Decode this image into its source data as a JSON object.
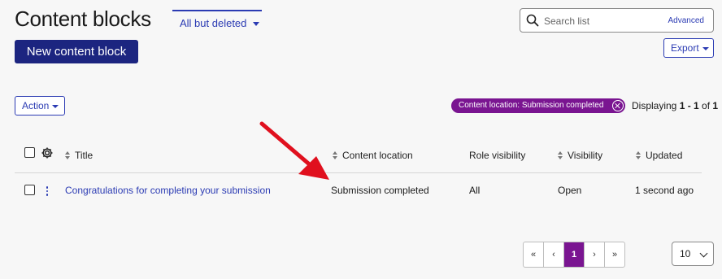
{
  "page": {
    "title": "Content blocks"
  },
  "filter": {
    "label": "All but deleted"
  },
  "toolbar": {
    "new_label": "New content block",
    "export_label": "Export",
    "action_label": "Action"
  },
  "search": {
    "placeholder": "Search list",
    "advanced_label": "Advanced"
  },
  "active_filter": {
    "label": "Content location: Submission completed"
  },
  "displaying": {
    "prefix": "Displaying ",
    "range": "1 - 1",
    "of": " of ",
    "total": "1"
  },
  "table": {
    "columns": [
      "Title",
      "Content location",
      "Role visibility",
      "Visibility",
      "Updated"
    ],
    "rows": [
      {
        "title": "Congratulations for completing your submission",
        "content_location": "Submission completed",
        "role_visibility": "All",
        "visibility": "Open",
        "updated": "1 second ago"
      }
    ]
  },
  "pagination": {
    "first": "«",
    "prev": "‹",
    "current": "1",
    "next": "›",
    "last": "»"
  },
  "per_page": {
    "value": "10"
  },
  "colors": {
    "primary": "#1c2580",
    "link": "#2b3bb3",
    "accent": "#7a1591",
    "annotation_arrow": "#e0101e"
  },
  "icons": [
    "search-icon",
    "gear-icon",
    "sort-icon",
    "kebab-menu-icon",
    "close-circle-icon",
    "chevron-down-icon",
    "annotation-arrow"
  ]
}
